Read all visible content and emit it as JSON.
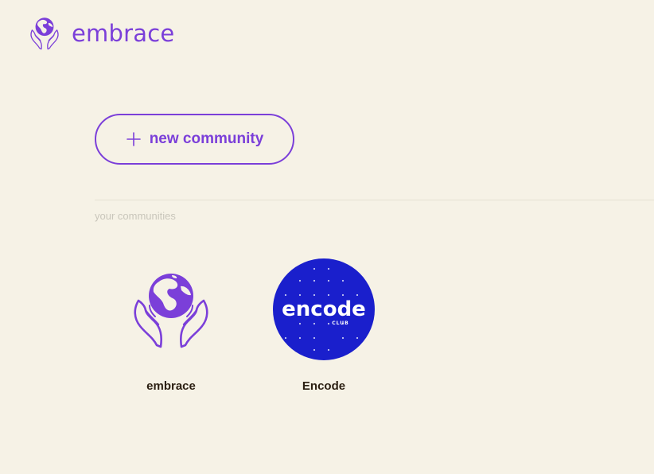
{
  "header": {
    "brand_name": "embrace",
    "logo_icon": "globe-in-hands-icon"
  },
  "actions": {
    "new_community_label": "new community",
    "new_community_icon": "plus-icon"
  },
  "communities_section": {
    "label": "your communities",
    "items": [
      {
        "name": "embrace",
        "avatar_icon": "globe-in-hands-icon"
      },
      {
        "name": "Encode",
        "avatar_icon": "encode-club-logo",
        "logo_text": "encode",
        "logo_subtext": "CLUB"
      }
    ]
  },
  "colors": {
    "background": "#f6f2e6",
    "accent": "#7b3fd9",
    "encode_blue": "#1a1fcc",
    "text_dark": "#2b1f12",
    "muted": "#c9c6bb"
  }
}
